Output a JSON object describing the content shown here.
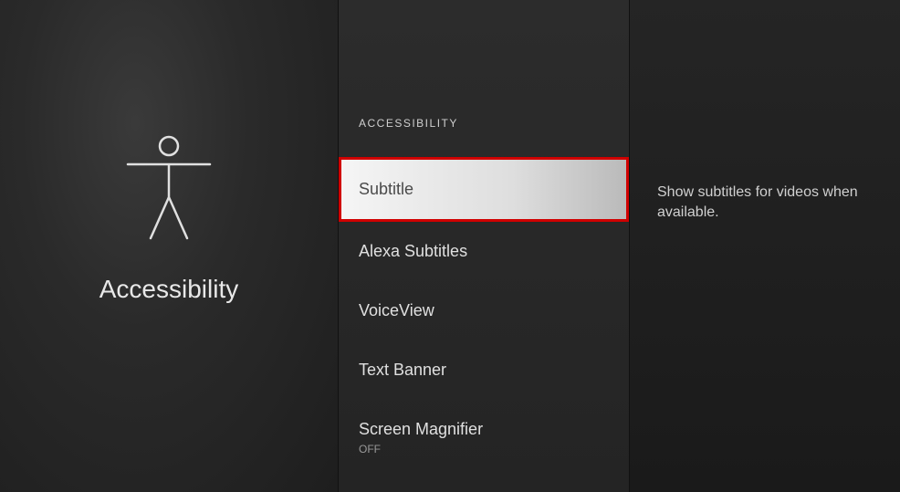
{
  "leftPanel": {
    "title": "Accessibility"
  },
  "middlePanel": {
    "sectionHeader": "ACCESSIBILITY",
    "items": [
      {
        "label": "Subtitle",
        "sub": null,
        "selected": true
      },
      {
        "label": "Alexa Subtitles",
        "sub": null,
        "selected": false
      },
      {
        "label": "VoiceView",
        "sub": null,
        "selected": false
      },
      {
        "label": "Text Banner",
        "sub": null,
        "selected": false
      },
      {
        "label": "Screen Magnifier",
        "sub": "OFF",
        "selected": false
      }
    ]
  },
  "rightPanel": {
    "description": "Show subtitles for videos when available."
  }
}
